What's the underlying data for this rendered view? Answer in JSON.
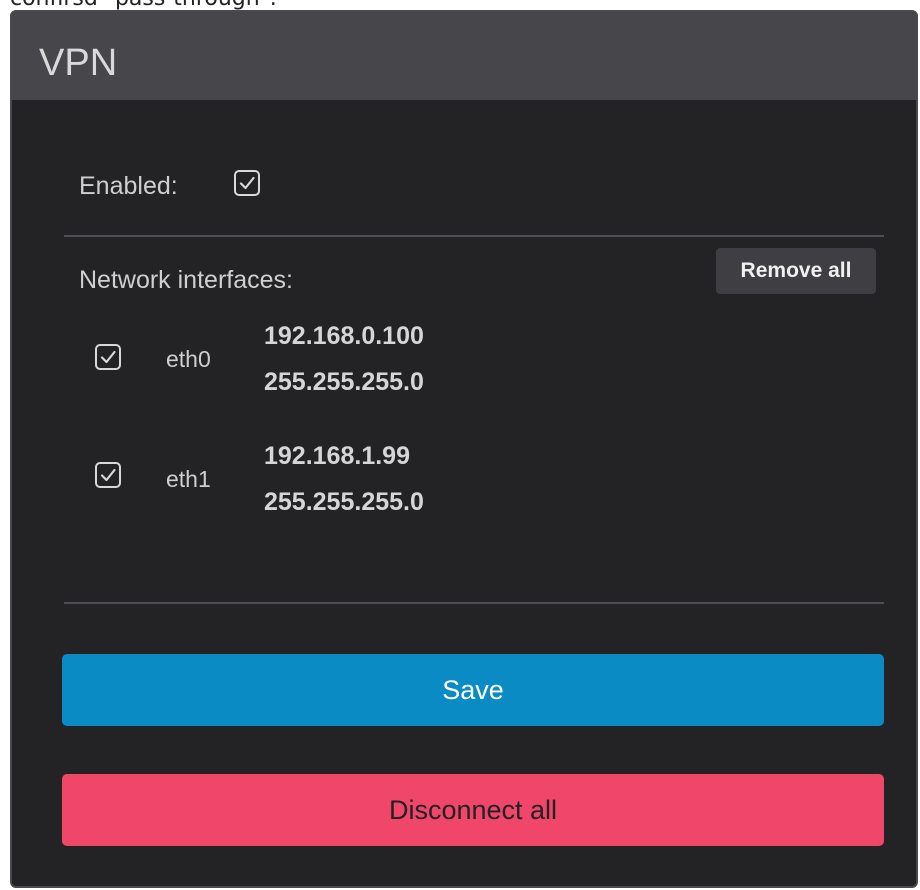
{
  "top_text": "confirsd \"pass-through\".",
  "vpn": {
    "title": "VPN",
    "enabled_label": "Enabled:",
    "enabled_checked": true,
    "network_interfaces_label": "Network interfaces:",
    "remove_all_label": "Remove all",
    "interfaces": [
      {
        "name": "eth0",
        "ip": "192.168.0.100",
        "mask": "255.255.255.0",
        "checked": true
      },
      {
        "name": "eth1",
        "ip": "192.168.1.99",
        "mask": "255.255.255.0",
        "checked": true
      }
    ],
    "save_label": "Save",
    "disconnect_label": "Disconnect all"
  },
  "colors": {
    "panel_bg": "#232326",
    "header_bg": "#46464b",
    "save": "#0a8bc4",
    "disconnect": "#f0466a"
  },
  "icons": [
    "checkbox-checked-icon"
  ]
}
